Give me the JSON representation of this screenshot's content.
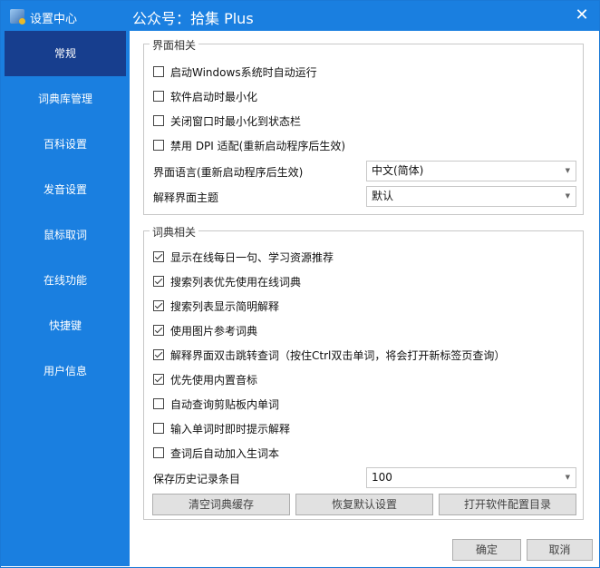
{
  "window": {
    "app_title": "设置中心",
    "header_title": "公众号：拾集 Plus",
    "close_label": "✕"
  },
  "sidebar": {
    "items": [
      {
        "label": "常规"
      },
      {
        "label": "词典库管理"
      },
      {
        "label": "百科设置"
      },
      {
        "label": "发音设置"
      },
      {
        "label": "鼠标取词"
      },
      {
        "label": "在线功能"
      },
      {
        "label": "快捷键"
      },
      {
        "label": "用户信息"
      }
    ]
  },
  "ui_group": {
    "title": "界面相关",
    "options": [
      {
        "label": "启动Windows系统时自动运行",
        "checked": false
      },
      {
        "label": "软件启动时最小化",
        "checked": false
      },
      {
        "label": "关闭窗口时最小化到状态栏",
        "checked": false
      },
      {
        "label": "禁用 DPI 适配(重新启动程序后生效)",
        "checked": false
      }
    ],
    "language_label": "界面语言(重新启动程序后生效)",
    "language_value": "中文(简体)",
    "theme_label": "解释界面主题",
    "theme_value": "默认"
  },
  "dict_group": {
    "title": "词典相关",
    "options": [
      {
        "label": "显示在线每日一句、学习资源推荐",
        "checked": true
      },
      {
        "label": "搜索列表优先使用在线词典",
        "checked": true
      },
      {
        "label": "搜索列表显示简明解释",
        "checked": true
      },
      {
        "label": "使用图片参考词典",
        "checked": true
      },
      {
        "label": "解释界面双击跳转查词（按住Ctrl双击单词，将会打开新标签页查询）",
        "checked": true
      },
      {
        "label": "优先使用内置音标",
        "checked": true
      },
      {
        "label": "自动查询剪贴板内单词",
        "checked": false
      },
      {
        "label": "输入单词时即时提示解释",
        "checked": false
      },
      {
        "label": "查词后自动加入生词本",
        "checked": false
      }
    ],
    "history_label": "保存历史记录条目",
    "history_value": "100",
    "buttons": {
      "clear_cache": "清空词典缓存",
      "restore_defaults": "恢复默认设置",
      "open_config_dir": "打开软件配置目录"
    }
  },
  "footer": {
    "ok": "确定",
    "cancel": "取消"
  }
}
